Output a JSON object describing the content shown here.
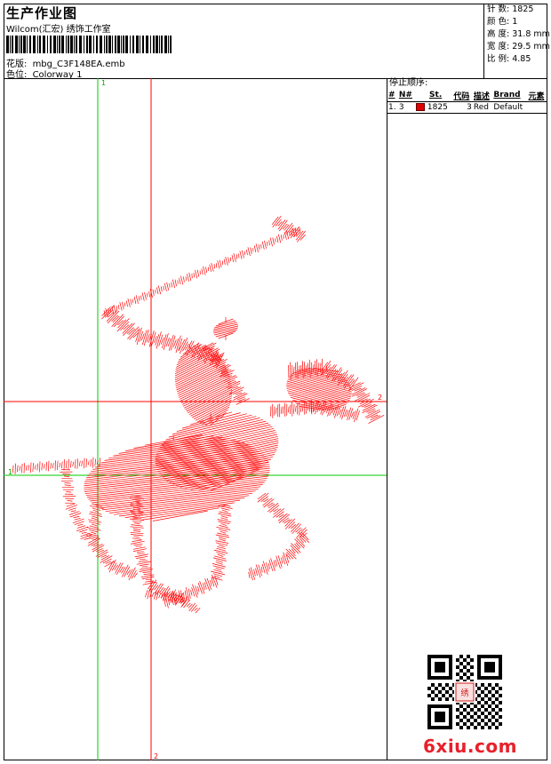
{
  "header": {
    "title": "生产作业图",
    "subtitle": "Wilcom(汇宏) 绣饰工作室",
    "design_label": "花版:",
    "design_file": "mbg_C3F148EA.emb",
    "colorway_label": "色位:",
    "colorway": "Colorway 1"
  },
  "stats": {
    "stitches": "针 数: 1825",
    "colors": "颜 色: 1",
    "height": "高 度: 31.8 mm",
    "width": "宽 度: 29.5 mm",
    "scale": "比 例: 4.85"
  },
  "canvas": {
    "guide_label_top": "1",
    "guide_label_right": "2",
    "guide_label_bottom": "2",
    "guide_label_left": "1",
    "colors": {
      "stitch": "#ff0000",
      "guide_green": "#00cc00",
      "guide_red": "#ff0000"
    }
  },
  "stop_sequence": {
    "title": "停止顺序:",
    "columns": [
      "#",
      "N#",
      "St.",
      "代码",
      "描述",
      "Brand",
      "元素"
    ],
    "rows": [
      {
        "index": "1.",
        "needle": "3",
        "swatch_color": "#e00000",
        "stitches": "1825",
        "code": "3",
        "description": "Red",
        "brand": "Default",
        "element": ""
      }
    ]
  },
  "watermark": {
    "site": "6xiu.com",
    "qr_label": "QR-code"
  }
}
